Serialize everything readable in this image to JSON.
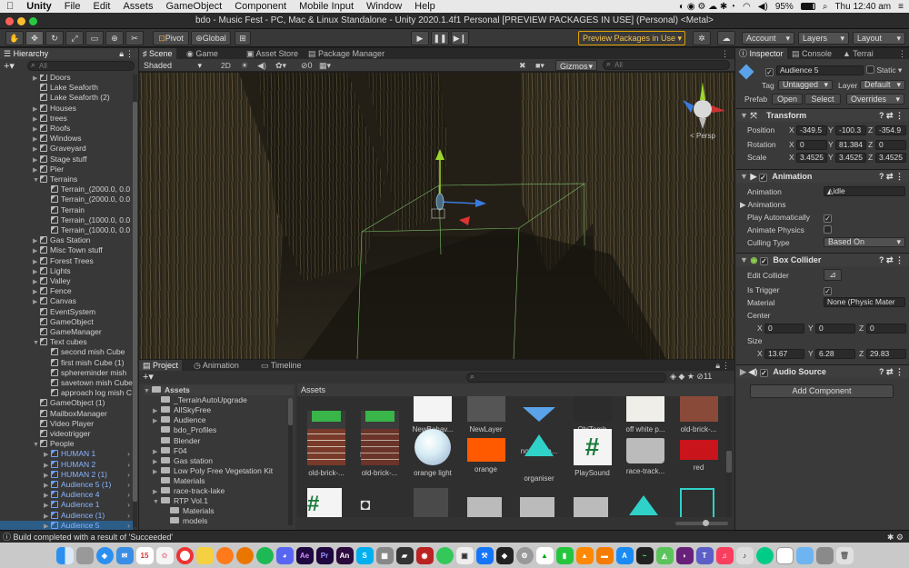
{
  "menubar": {
    "apple": "",
    "app_name": "Unity",
    "menus": [
      "File",
      "Edit",
      "Assets",
      "GameObject",
      "Component",
      "Mobile Input",
      "Window",
      "Help"
    ],
    "battery": "95%",
    "clock": "Thu 12:40 am"
  },
  "window": {
    "title": "bdo - Music Fest - PC, Mac & Linux Standalone - Unity 2020.1.4f1 Personal [PREVIEW PACKAGES IN USE] (Personal) <Metal>"
  },
  "toolbar": {
    "pivot": "Pivot",
    "global": "Global",
    "preview_packages": "Preview Packages in Use",
    "account": "Account",
    "layers": "Layers",
    "layout": "Layout"
  },
  "hierarchy": {
    "tab": "Hierarchy",
    "search_placeholder": "All",
    "items": [
      {
        "label": "Doors",
        "depth": 0,
        "arrow": "▶",
        "style": ""
      },
      {
        "label": "Lake Seaforth",
        "depth": 0,
        "arrow": "",
        "style": ""
      },
      {
        "label": "Lake Seaforth (2)",
        "depth": 0,
        "arrow": "",
        "style": ""
      },
      {
        "label": "Houses",
        "depth": 0,
        "arrow": "▶",
        "style": ""
      },
      {
        "label": "trees",
        "depth": 0,
        "arrow": "▶",
        "style": ""
      },
      {
        "label": "Roofs",
        "depth": 0,
        "arrow": "▶",
        "style": ""
      },
      {
        "label": "Windows",
        "depth": 0,
        "arrow": "▶",
        "style": ""
      },
      {
        "label": "Graveyard",
        "depth": 0,
        "arrow": "▶",
        "style": ""
      },
      {
        "label": "Stage stuff",
        "depth": 0,
        "arrow": "▶",
        "style": ""
      },
      {
        "label": "Pier",
        "depth": 0,
        "arrow": "▶",
        "style": ""
      },
      {
        "label": "Terrains",
        "depth": 0,
        "arrow": "▼",
        "style": ""
      },
      {
        "label": "Terrain_(2000.0, 0.0",
        "depth": 1,
        "arrow": "",
        "style": ""
      },
      {
        "label": "Terrain_(2000.0, 0.0",
        "depth": 1,
        "arrow": "",
        "style": ""
      },
      {
        "label": "Terrain",
        "depth": 1,
        "arrow": "",
        "style": ""
      },
      {
        "label": "Terrain_(1000.0, 0.0",
        "depth": 1,
        "arrow": "",
        "style": ""
      },
      {
        "label": "Terrain_(1000.0, 0.0",
        "depth": 1,
        "arrow": "",
        "style": ""
      },
      {
        "label": "Gas Station",
        "depth": 0,
        "arrow": "▶",
        "style": ""
      },
      {
        "label": "Misc Town stuff",
        "depth": 0,
        "arrow": "▶",
        "style": ""
      },
      {
        "label": "Forest Trees",
        "depth": 0,
        "arrow": "▶",
        "style": ""
      },
      {
        "label": "Lights",
        "depth": 0,
        "arrow": "▶",
        "style": ""
      },
      {
        "label": "Valley",
        "depth": 0,
        "arrow": "▶",
        "style": ""
      },
      {
        "label": "Fence",
        "depth": 0,
        "arrow": "▶",
        "style": ""
      },
      {
        "label": "Canvas",
        "depth": 0,
        "arrow": "▶",
        "style": ""
      },
      {
        "label": "EventSystem",
        "depth": 0,
        "arrow": "",
        "style": ""
      },
      {
        "label": "GameObject",
        "depth": 0,
        "arrow": "",
        "style": ""
      },
      {
        "label": "GameManager",
        "depth": 0,
        "arrow": "",
        "style": ""
      },
      {
        "label": "Text cubes",
        "depth": 0,
        "arrow": "▼",
        "style": ""
      },
      {
        "label": "second mish Cube",
        "depth": 1,
        "arrow": "",
        "style": ""
      },
      {
        "label": "first mish Cube (1)",
        "depth": 1,
        "arrow": "",
        "style": ""
      },
      {
        "label": "sphereminder mish",
        "depth": 1,
        "arrow": "",
        "style": ""
      },
      {
        "label": "savetown mish Cube",
        "depth": 1,
        "arrow": "",
        "style": ""
      },
      {
        "label": "approach log mish C",
        "depth": 1,
        "arrow": "",
        "style": ""
      },
      {
        "label": "GameObject (1)",
        "depth": 0,
        "arrow": "",
        "style": ""
      },
      {
        "label": "MailboxManager",
        "depth": 0,
        "arrow": "",
        "style": ""
      },
      {
        "label": "Video Player",
        "depth": 0,
        "arrow": "",
        "style": ""
      },
      {
        "label": "videotrigger",
        "depth": 0,
        "arrow": "",
        "style": ""
      },
      {
        "label": "People",
        "depth": 0,
        "arrow": "▼",
        "style": ""
      },
      {
        "label": "HUMAN 1",
        "depth": 1,
        "arrow": "▶",
        "style": "blue"
      },
      {
        "label": "HUMAN 2",
        "depth": 1,
        "arrow": "▶",
        "style": "blue"
      },
      {
        "label": "HUMAN 2 (1)",
        "depth": 1,
        "arrow": "▶",
        "style": "blue"
      },
      {
        "label": "Audience 5 (1)",
        "depth": 1,
        "arrow": "▶",
        "style": "blue"
      },
      {
        "label": "Audience 4",
        "depth": 1,
        "arrow": "▶",
        "style": "blue"
      },
      {
        "label": "Audience 1",
        "depth": 1,
        "arrow": "▶",
        "style": "blue"
      },
      {
        "label": "Audience (1)",
        "depth": 1,
        "arrow": "▶",
        "style": "blue"
      },
      {
        "label": "Audience 5",
        "depth": 1,
        "arrow": "▶",
        "style": "blue sel"
      }
    ]
  },
  "scene": {
    "tabs": [
      "Scene",
      "Game",
      "Asset Store",
      "Package Manager"
    ],
    "shading": "Shaded",
    "mode_2d": "2D",
    "gizmos": "Gizmos",
    "search_placeholder": "All",
    "persp": "< Persp",
    "fx_count": "0"
  },
  "project": {
    "tabs": [
      "Project",
      "Animation",
      "Timeline"
    ],
    "assets_header": "Assets",
    "count": "11",
    "folders": [
      {
        "label": "Assets",
        "depth": 0,
        "arrow": "▼",
        "bold": true
      },
      {
        "label": "_TerrainAutoUpgrade",
        "depth": 1,
        "arrow": ""
      },
      {
        "label": "AllSkyFree",
        "depth": 1,
        "arrow": "▶"
      },
      {
        "label": "Audience",
        "depth": 1,
        "arrow": "▶"
      },
      {
        "label": "bdo_Profiles",
        "depth": 1,
        "arrow": ""
      },
      {
        "label": "Blender",
        "depth": 1,
        "arrow": ""
      },
      {
        "label": "F04",
        "depth": 1,
        "arrow": "▶"
      },
      {
        "label": "Gas station",
        "depth": 1,
        "arrow": "▶"
      },
      {
        "label": "Low Poly Free Vegetation Kit",
        "depth": 1,
        "arrow": "▶"
      },
      {
        "label": "Materials",
        "depth": 1,
        "arrow": ""
      },
      {
        "label": "race-track-lake",
        "depth": 1,
        "arrow": "▶"
      },
      {
        "label": "RTP Vol.1",
        "depth": 1,
        "arrow": "▼"
      },
      {
        "label": "Materials",
        "depth": 2,
        "arrow": ""
      },
      {
        "label": "models",
        "depth": 2,
        "arrow": ""
      }
    ],
    "row1": [
      "New Terra...",
      "New Terra...",
      "NewBehav...",
      "NewLayer",
      "notificatio...",
      "ObjTomb",
      "off white p...",
      "old-brick-..."
    ],
    "row2": [
      "old-brick-...",
      "old-brick-...",
      "orange light",
      "orange",
      "organiser",
      "PlaySound",
      "race-track...",
      "red"
    ]
  },
  "inspector": {
    "tabs": [
      "Inspector",
      "Console",
      "Terrai"
    ],
    "object_name": "Audience 5",
    "static_label": "Static",
    "tag_label": "Tag",
    "tag_value": "Untagged",
    "layer_label": "Layer",
    "layer_value": "Default",
    "prefab_label": "Prefab",
    "open": "Open",
    "select": "Select",
    "overrides": "Overrides",
    "transform": {
      "title": "Transform",
      "position_label": "Position",
      "position": [
        "-349.5",
        "-100.3",
        "-354.9"
      ],
      "rotation_label": "Rotation",
      "rotation": [
        "0",
        "81.384",
        "0"
      ],
      "scale_label": "Scale",
      "scale": [
        "3.4525",
        "3.4525",
        "3.4525"
      ]
    },
    "animation": {
      "title": "Animation",
      "animation_label": "Animation",
      "animation_value": "idle",
      "animations_label": "Animations",
      "play_auto_label": "Play Automatically",
      "animate_physics_label": "Animate Physics",
      "culling_label": "Culling Type",
      "culling_value": "Based On Renderers"
    },
    "box_collider": {
      "title": "Box Collider",
      "edit_label": "Edit Collider",
      "trigger_label": "Is Trigger",
      "material_label": "Material",
      "material_value": "None (Physic Mater",
      "center_label": "Center",
      "center": [
        "0",
        "0",
        "0"
      ],
      "size_label": "Size",
      "size": [
        "13.67",
        "6.28",
        "29.83"
      ]
    },
    "audio_source": {
      "title": "Audio Source"
    },
    "add_component": "Add Component"
  },
  "status": {
    "message": "Build completed with a result of 'Succeeded'"
  },
  "colors": {
    "selection": "#2c5d87",
    "prefab_blue": "#8ab4ff",
    "preview_border": "#e0a000"
  }
}
